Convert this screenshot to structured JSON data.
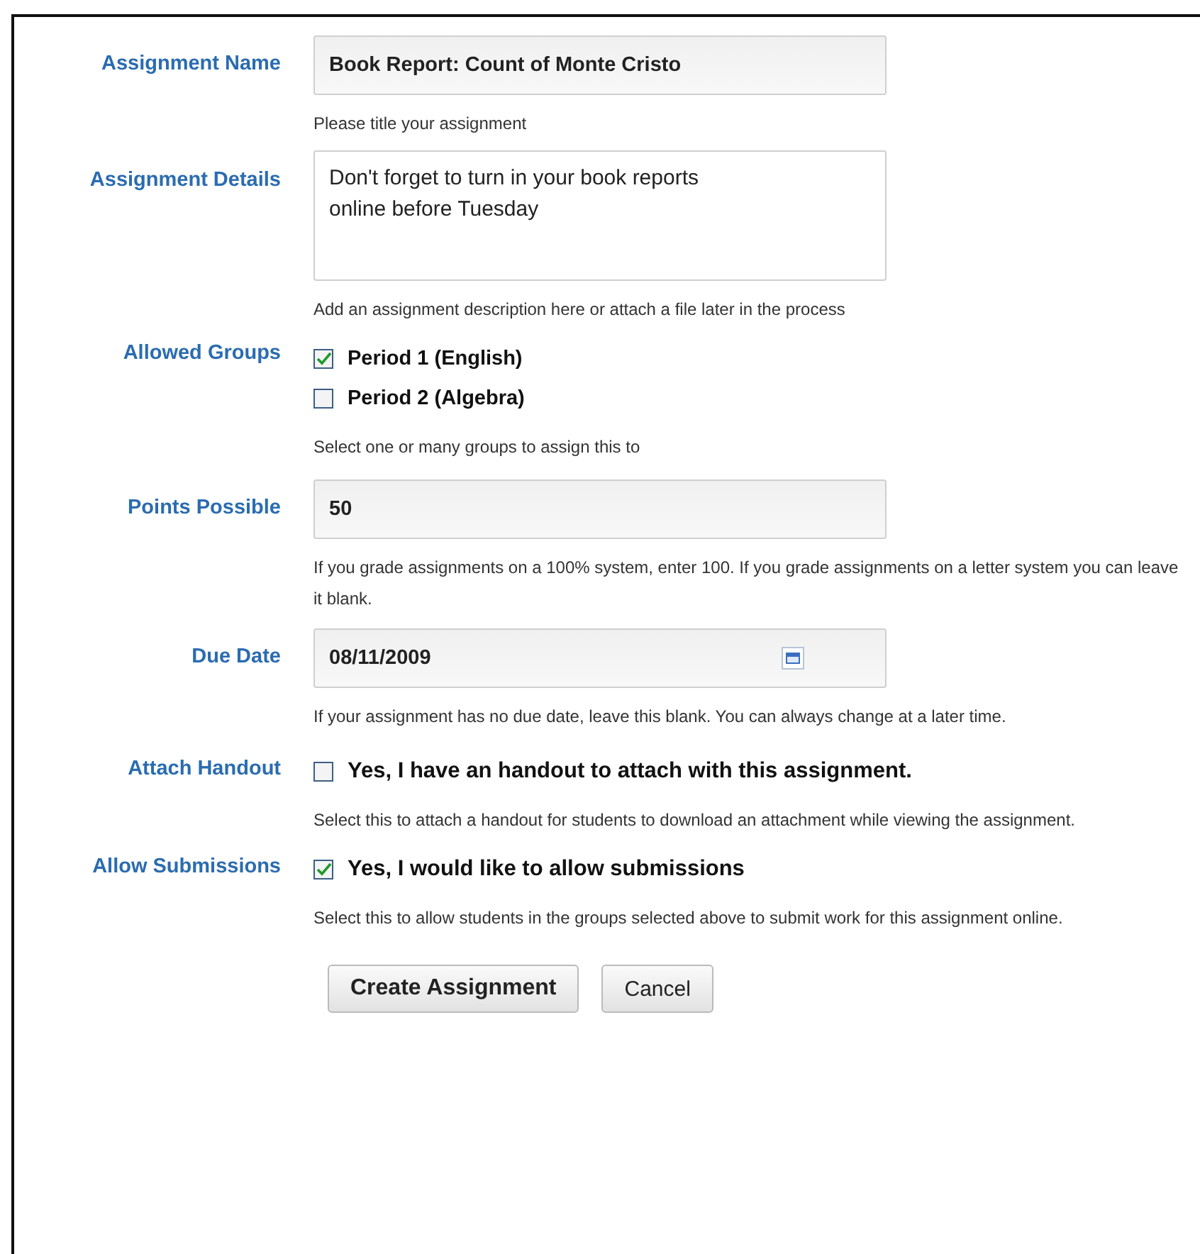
{
  "fields": [
    {
      "kind": "text",
      "label": "Assignment Name",
      "value": "Book Report: Count of Monte Cristo",
      "help": "Please title your assignment"
    },
    {
      "kind": "textarea",
      "label": "Assignment Details",
      "value": "Don't forget to turn in your book reports\nonline before Tuesday",
      "help": "Add an assignment description here or attach a file later in the process"
    },
    {
      "kind": "checkboxes",
      "label": "Allowed Groups",
      "options": [
        {
          "label": "Period 1 (English)",
          "checked": true
        },
        {
          "label": "Period 2 (Algebra)",
          "checked": false
        }
      ],
      "help": "Select one or many groups to assign this to"
    },
    {
      "kind": "text",
      "label": "Points Possible",
      "value": "50",
      "help": "If you grade assignments on a 100% system, enter 100. If you grade assignments on a letter system you can leave it blank."
    },
    {
      "kind": "date",
      "label": "Due Date",
      "value": "08/11/2009",
      "help": "If your assignment has no due date, leave this blank. You can always change at a later time."
    },
    {
      "kind": "checkbox",
      "label": "Attach Handout",
      "option": {
        "label": "Yes, I have an handout to attach with this assignment.",
        "checked": false
      },
      "help": "Select this to attach a handout for students to download an attachment while viewing the assignment."
    },
    {
      "kind": "checkbox",
      "label": "Allow Submissions",
      "option": {
        "label": "Yes, I would like to allow submissions",
        "checked": true
      },
      "help": "Select this to allow students in the groups selected above to submit work for this assignment online."
    }
  ],
  "buttons": [
    {
      "label": "Create Assignment",
      "kind": "primary"
    },
    {
      "label": "Cancel",
      "kind": "secondary"
    }
  ]
}
